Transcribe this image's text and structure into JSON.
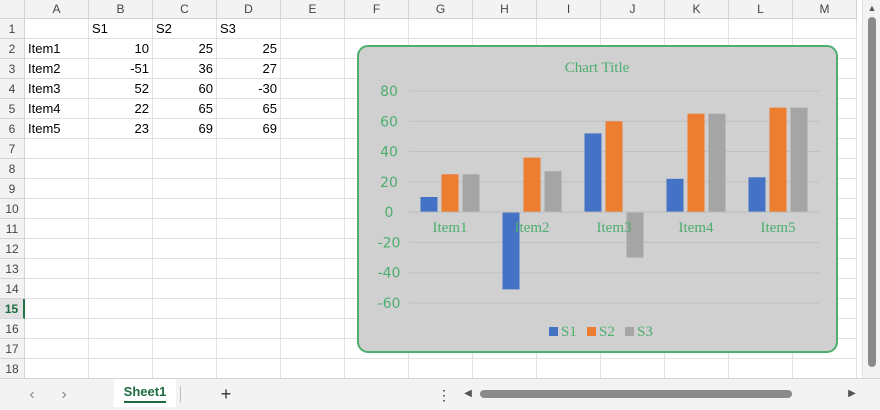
{
  "columns": [
    "A",
    "B",
    "C",
    "D",
    "E",
    "F",
    "G",
    "H",
    "I",
    "J",
    "K",
    "L",
    "M"
  ],
  "rows": [
    "1",
    "2",
    "3",
    "4",
    "5",
    "6",
    "7",
    "8",
    "9",
    "10",
    "11",
    "12",
    "13",
    "14",
    "15",
    "16",
    "17",
    "18"
  ],
  "selected_row": "15",
  "cells": {
    "headers": [
      "",
      "S1",
      "S2",
      "S3"
    ],
    "data": [
      [
        "Item1",
        "10",
        "25",
        "25"
      ],
      [
        "Item2",
        "-51",
        "36",
        "27"
      ],
      [
        "Item3",
        "52",
        "60",
        "-30"
      ],
      [
        "Item4",
        "22",
        "65",
        "65"
      ],
      [
        "Item5",
        "23",
        "69",
        "69"
      ]
    ]
  },
  "chart_data": {
    "type": "bar",
    "title": "Chart Title",
    "categories": [
      "Item1",
      "Item2",
      "Item3",
      "Item4",
      "Item5"
    ],
    "series": [
      {
        "name": "S1",
        "values": [
          10,
          -51,
          52,
          22,
          23
        ],
        "color": "#4472c4"
      },
      {
        "name": "S2",
        "values": [
          25,
          36,
          60,
          65,
          69
        ],
        "color": "#ed7d31"
      },
      {
        "name": "S3",
        "values": [
          25,
          27,
          -30,
          65,
          69
        ],
        "color": "#a5a5a5"
      }
    ],
    "ylim": [
      -60,
      80
    ],
    "yticks": [
      "80",
      "60",
      "40",
      "20",
      "0",
      "-20",
      "-40",
      "-60"
    ],
    "xlabel": "",
    "ylabel": "",
    "grid": true,
    "legend": "bottom",
    "text_color": "#4dae6f",
    "background": "#d0d0d0",
    "border_color": "#4dae6f"
  },
  "status_bar": {
    "prev_icon": "chevron-left-icon",
    "next_icon": "chevron-right-icon",
    "sheet_tab": "Sheet1",
    "add_sheet_label": "+",
    "more_options_label": "⋮",
    "accent": "#1e6b40"
  }
}
